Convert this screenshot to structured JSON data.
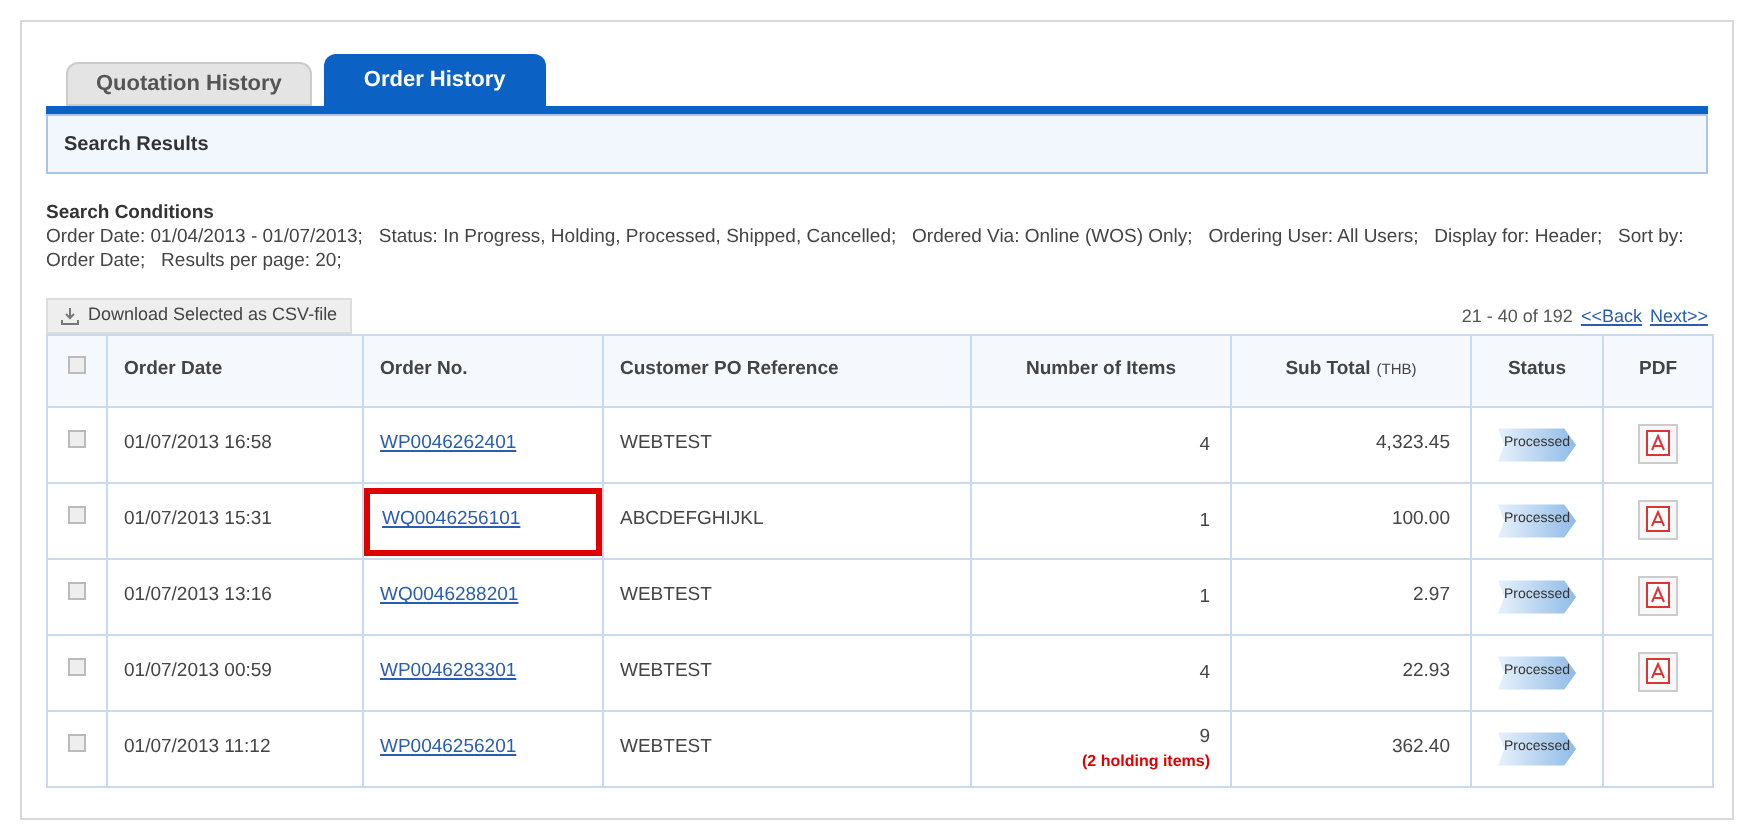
{
  "tabs": [
    {
      "label": "Quotation History",
      "selected": false
    },
    {
      "label": "Order History",
      "selected": true
    }
  ],
  "section_title": "Search Results",
  "conditions": {
    "title": "Search Conditions",
    "text": "Order Date: 01/04/2013 - 01/07/2013;   Status: In Progress, Holding, Processed, Shipped, Cancelled;   Ordered Via: Online (WOS) Only;   Ordering User: All Users;   Display for: Header;   Sort by: Order Date;   Results per page: 20;"
  },
  "download_button": "Download Selected as CSV-file",
  "pagination": {
    "range": "21 - 40 of 192",
    "back": "<<Back",
    "next": "Next>>"
  },
  "table": {
    "columns": [
      "Order Date",
      "Order No.",
      "Customer PO Reference",
      "Number of Items",
      "Sub Total",
      "Status",
      "PDF"
    ],
    "currency": "(THB)",
    "select_all_checked": false,
    "rows": [
      {
        "checked": false,
        "date": "01/07/2013 16:58",
        "order_no": "WP0046262401",
        "highlighted": false,
        "po": "WEBTEST",
        "items": "4",
        "subtotal": "4,323.45",
        "status": "Processed",
        "pdf": true
      },
      {
        "checked": false,
        "date": "01/07/2013 15:31",
        "order_no": "WQ0046256101",
        "highlighted": true,
        "po": "ABCDEFGHIJKL",
        "items": "1",
        "subtotal": "100.00",
        "status": "Processed",
        "pdf": true
      },
      {
        "checked": false,
        "date": "01/07/2013 13:16",
        "order_no": "WQ0046288201",
        "highlighted": false,
        "po": "WEBTEST",
        "items": "1",
        "subtotal": "2.97",
        "status": "Processed",
        "pdf": true
      },
      {
        "checked": false,
        "date": "01/07/2013 00:59",
        "order_no": "WP0046283301",
        "highlighted": false,
        "po": "WEBTEST",
        "items": "4",
        "subtotal": "22.93",
        "status": "Processed",
        "pdf": true
      },
      {
        "checked": false,
        "date": "01/07/2013 11:12",
        "order_no": "WP0046256201",
        "highlighted": false,
        "po": "WEBTEST",
        "items": "9",
        "note": "(2 holding items)",
        "subtotal": "362.40",
        "status": "Processed",
        "pdf": false
      }
    ]
  }
}
